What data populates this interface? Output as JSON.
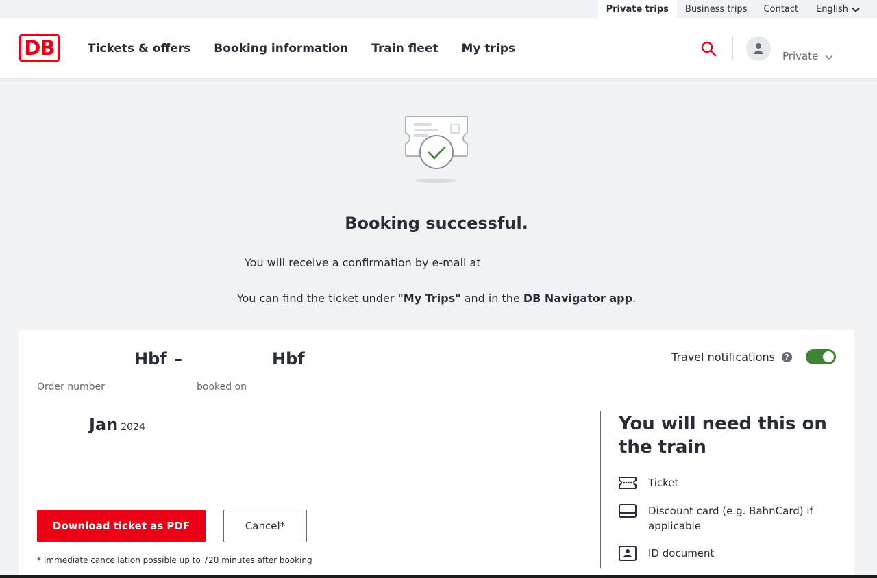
{
  "metabar": {
    "private_trips": "Private trips",
    "business_trips": "Business trips",
    "contact": "Contact",
    "language": "English"
  },
  "header": {
    "logo_text": "DB",
    "nav": [
      "Tickets & offers",
      "Booking information",
      "Train fleet",
      "My trips"
    ],
    "account_label": "Private"
  },
  "success": {
    "title": "Booking successful.",
    "confirmation_text": "You will receive a confirmation by e-mail at",
    "find_prefix": "You can find the ticket under ",
    "find_my_trips": "\"My Trips\"",
    "find_middle": " and in the ",
    "find_app": "DB Navigator app",
    "find_suffix": "."
  },
  "card": {
    "origin": "Hbf",
    "separator": "–",
    "destination": "Hbf",
    "order_number_label": "Order number",
    "booked_on_label": "booked on",
    "travel_notifications_label": "Travel notifications",
    "travel_notifications_on": true,
    "date_month": "Jan",
    "date_year": "2024",
    "download_button": "Download ticket as PDF",
    "cancel_button": "Cancel*",
    "cancel_note": "* Immediate cancellation possible up to 720 minutes after booking",
    "need_title": "You will need this on the train",
    "need_items": [
      {
        "icon": "ticket-icon",
        "label": "Ticket"
      },
      {
        "icon": "card-icon",
        "label": "Discount card (e.g. BahnCard) if applicable"
      },
      {
        "icon": "id-icon",
        "label": "ID document"
      }
    ]
  },
  "colors": {
    "brand_red": "#ec0016",
    "toggle_green": "#408335",
    "text": "#282d37",
    "muted": "#646973",
    "background": "#f0f3f5"
  }
}
